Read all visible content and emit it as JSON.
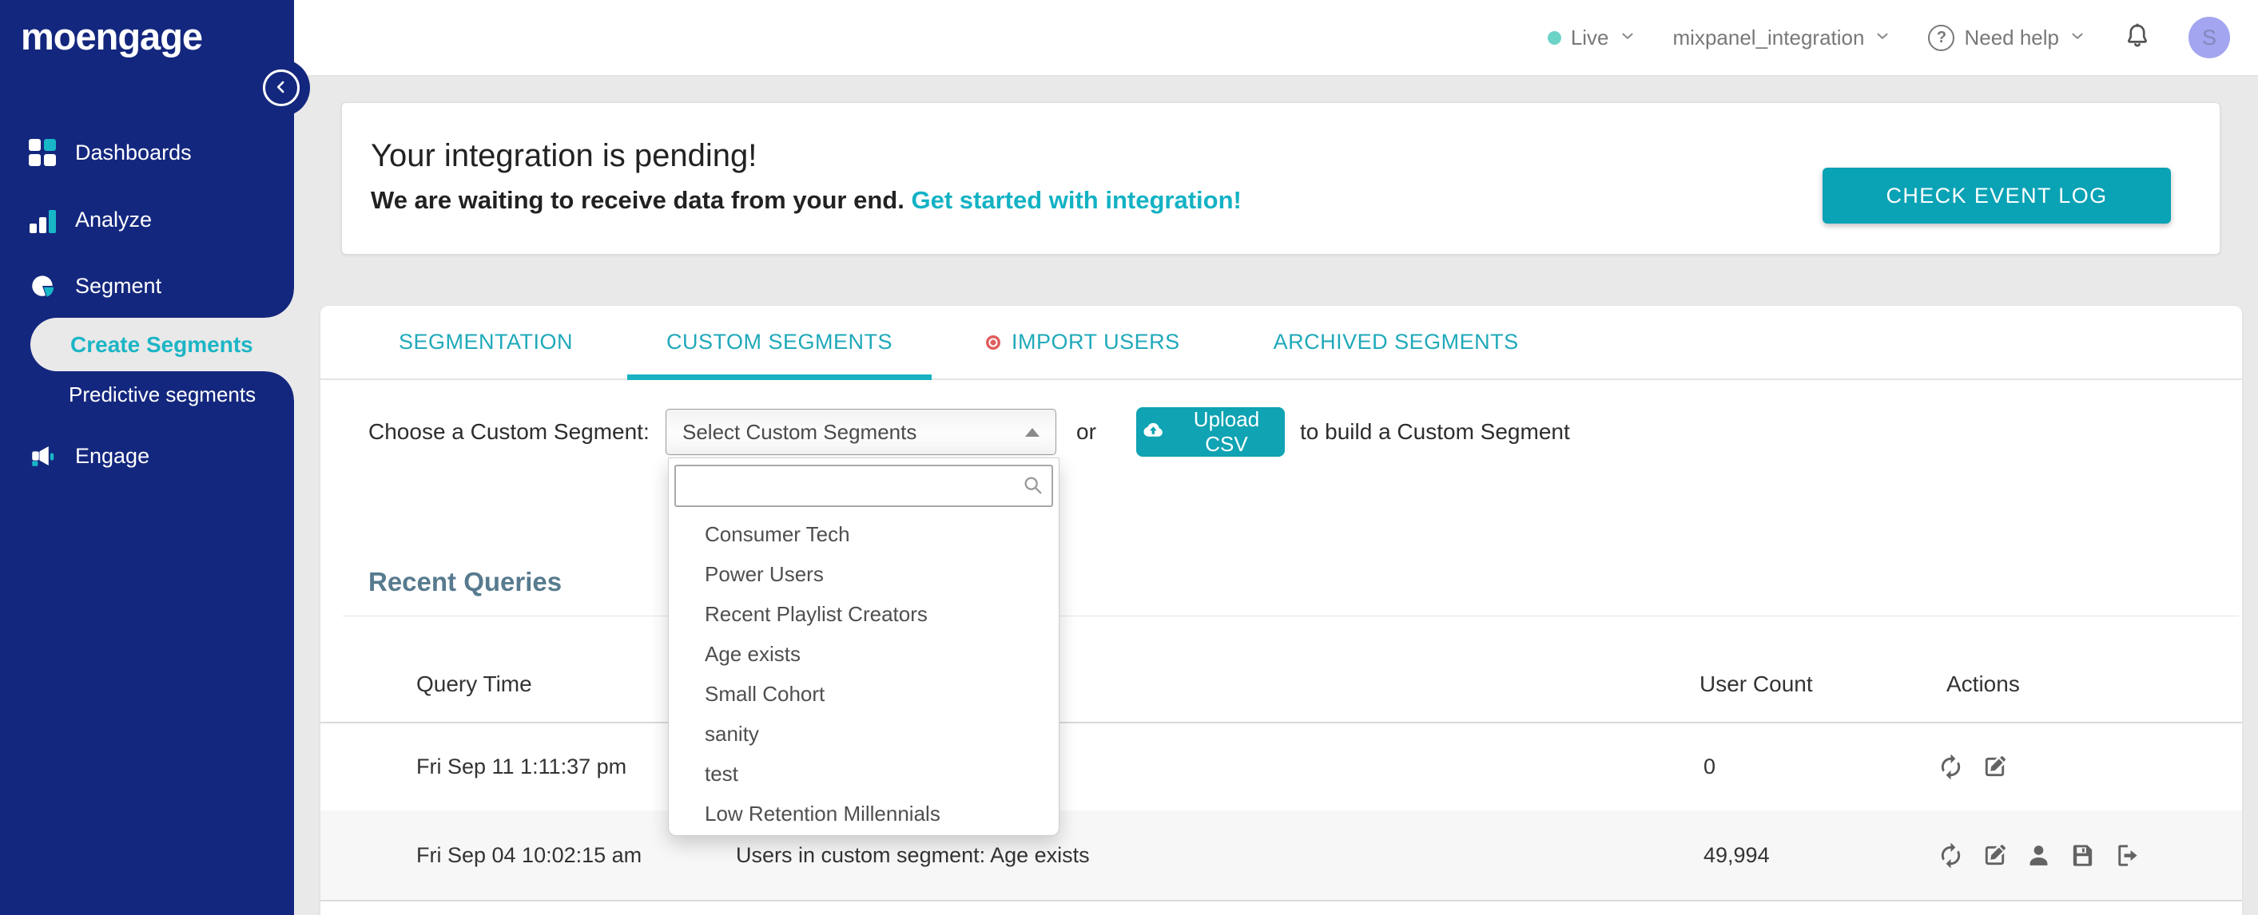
{
  "sidebar": {
    "logo_text": "moengage",
    "items": [
      {
        "label": "Dashboards",
        "active": false
      },
      {
        "label": "Analyze",
        "active": false
      },
      {
        "label": "Segment",
        "active": false
      },
      {
        "label": "Create Segments",
        "active": true
      },
      {
        "label": "Predictive segments",
        "active": false
      },
      {
        "label": "Engage",
        "active": false
      }
    ]
  },
  "header": {
    "environment_label": "Live",
    "workspace_name": "mixpanel_integration",
    "help_label": "Need help",
    "help_icon_glyph": "?",
    "avatar_initial": "S"
  },
  "banner": {
    "title": "Your integration is pending!",
    "message": "We are waiting to receive data from your end.",
    "link_text": "Get started with integration!",
    "button_label": "CHECK EVENT LOG"
  },
  "tabs": {
    "items": [
      {
        "label": "SEGMENTATION",
        "active": false
      },
      {
        "label": "CUSTOM SEGMENTS",
        "active": true
      },
      {
        "label": "IMPORT USERS",
        "active": false,
        "has_red_dot": true
      },
      {
        "label": "ARCHIVED SEGMENTS",
        "active": false
      }
    ]
  },
  "chooser": {
    "label": "Choose a Custom Segment:",
    "select_value": "Select Custom Segments",
    "or_text": "or",
    "upload_button_label": "Upload CSV",
    "suffix_text": "to build a Custom Segment",
    "search_value": "",
    "options": [
      "Consumer Tech",
      "Power Users",
      "Recent Playlist Creators",
      "Age exists",
      "Small Cohort",
      "sanity",
      "test",
      "Low Retention Millennials"
    ]
  },
  "recent_queries": {
    "title": "Recent Queries",
    "columns": {
      "time": "Query Time",
      "user_count": "User Count",
      "actions": "Actions"
    },
    "rows": [
      {
        "query_time": "Fri Sep 11 1:11:37 pm",
        "description": "",
        "user_count": "0",
        "actions": [
          "refresh",
          "edit"
        ]
      },
      {
        "query_time": "Fri Sep 04 10:02:15 am",
        "description": "Users in custom segment: Age exists",
        "user_count": "49,994",
        "actions": [
          "refresh",
          "edit",
          "user",
          "save",
          "export"
        ]
      }
    ]
  },
  "colors": {
    "brand_navy": "#14277e",
    "accent_teal": "#0fa3b3",
    "active_link_teal": "#1cb5c5",
    "live_dot_teal": "#6bd3c8",
    "import_dot_red": "#e05e5e",
    "heading_slate": "#577a8e",
    "avatar_bg": "#a3a5f0"
  }
}
